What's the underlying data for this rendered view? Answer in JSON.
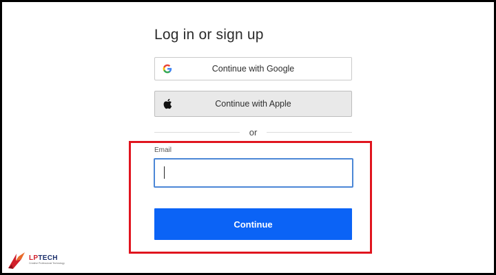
{
  "login": {
    "title": "Log in or sign up",
    "google_label": "Continue with Google",
    "apple_label": "Continue with Apple",
    "or_text": "or",
    "email_label": "Email",
    "email_value": "",
    "continue_label": "Continue"
  },
  "watermark": {
    "brand_prefix": "LP",
    "brand_suffix": "TECH",
    "tagline": "Creative Professional Technology"
  },
  "colors": {
    "primary_button": "#0b63f6",
    "input_focus_border": "#4a86d6",
    "highlight_box": "#e0141e",
    "apple_button_bg": "#e9e9e9"
  },
  "icons": {
    "google": "google-icon",
    "apple": "apple-icon"
  }
}
